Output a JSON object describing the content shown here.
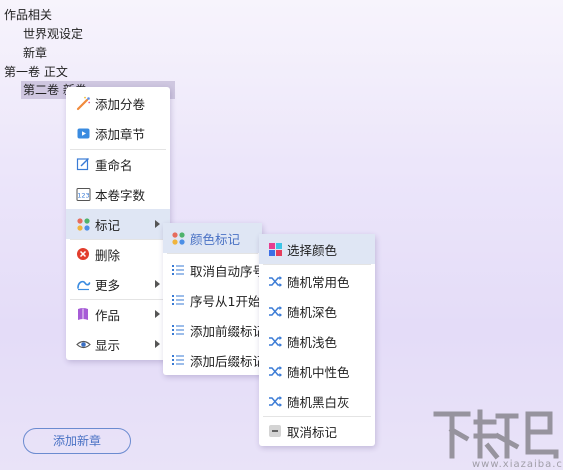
{
  "tree": {
    "works_related": "作品相关",
    "world_setting": "世界观设定",
    "new_chapter": "新章",
    "volume1": "第一卷 正文",
    "volume2": "第二卷 新卷"
  },
  "context_menu": {
    "add_volume": "添加分卷",
    "add_chapter": "添加章节",
    "rename": "重命名",
    "volume_word_count": "本卷字数",
    "mark": "标记",
    "delete": "删除",
    "more": "更多",
    "works": "作品",
    "display": "显示"
  },
  "mark_submenu": {
    "color_mark": "颜色标记",
    "cancel_auto_number": "取消自动序号",
    "number_from_1": "序号从1开始",
    "add_prefix_mark": "添加前缀标记",
    "add_suffix_mark": "添加后缀标记"
  },
  "color_submenu": {
    "choose_color": "选择颜色",
    "random_common": "随机常用色",
    "random_dark": "随机深色",
    "random_light": "随机浅色",
    "random_neutral": "随机中性色",
    "random_bw": "随机黑白灰",
    "cancel_mark": "取消标记"
  },
  "add_new_chapter_button": "添加新章",
  "watermark": {
    "logo_text": "下载吧",
    "url": "www.xiazaiba.com"
  },
  "colors": {
    "highlight": "#dfe6f4",
    "accent_blue": "#4a72c4",
    "selected_node": "#cfc7e0"
  }
}
